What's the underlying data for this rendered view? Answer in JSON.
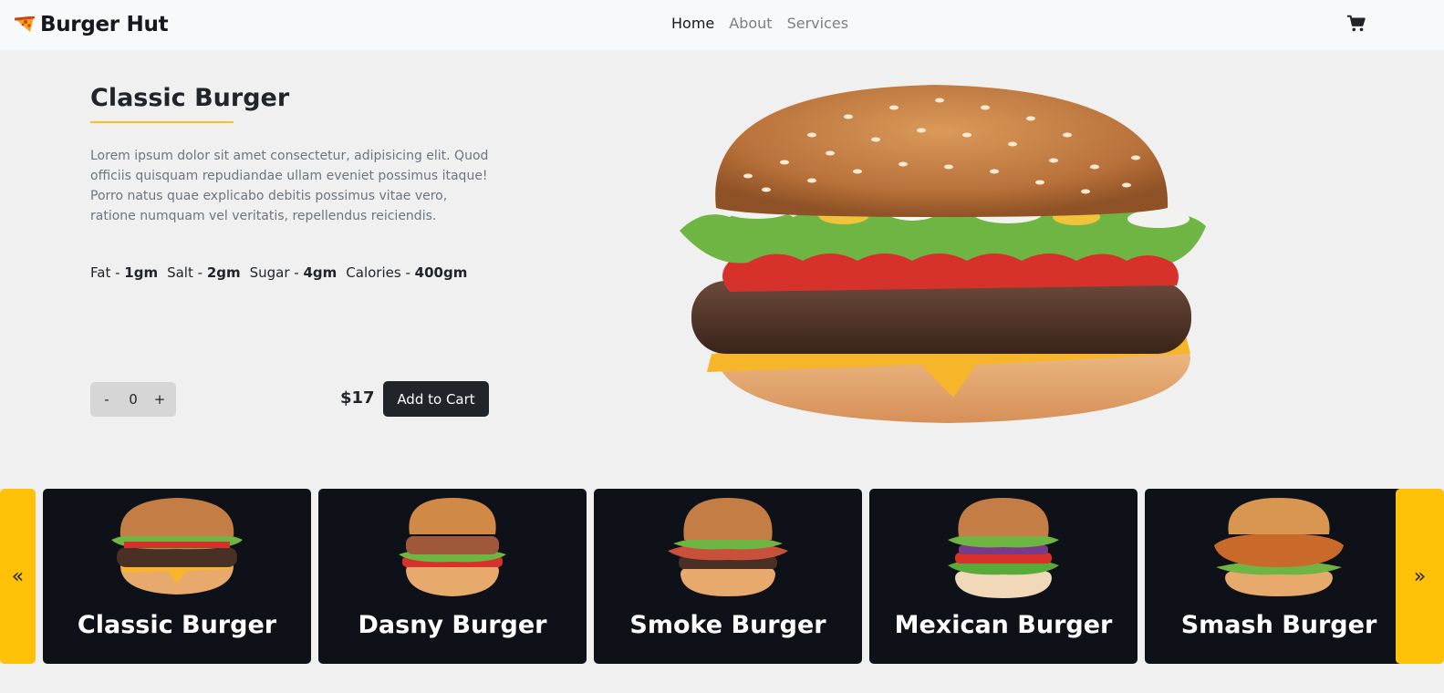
{
  "navbar": {
    "brand": "Burger Hut",
    "links": [
      "Home",
      "About",
      "Services"
    ],
    "active": "Home"
  },
  "product": {
    "title": "Classic Burger",
    "description": "Lorem ipsum dolor sit amet consectetur, adipisicing elit. Quod officiis quisquam repudiandae ullam eveniet possimus itaque! Porro natus quae explicabo debitis possimus vitae vero, ratione numquam vel veritatis, repellendus reiciendis.",
    "nutrition": [
      {
        "label": "Fat - ",
        "value": "1gm"
      },
      {
        "label": "Salt - ",
        "value": "2gm"
      },
      {
        "label": "Sugar - ",
        "value": "4gm"
      },
      {
        "label": "Calories - ",
        "value": "400gm"
      }
    ],
    "quantity": {
      "minus": "-",
      "value": "0",
      "plus": "+"
    },
    "price": "$17",
    "add_to_cart": "Add to Cart"
  },
  "carousel": {
    "prev": "«",
    "next": "»",
    "items": [
      {
        "name": "Classic Burger"
      },
      {
        "name": "Dasny Burger"
      },
      {
        "name": "Smoke Burger"
      },
      {
        "name": "Mexican Burger"
      },
      {
        "name": "Smash Burger"
      }
    ]
  },
  "colors": {
    "accent": "#ffc107",
    "dark": "#212529",
    "card_bg": "#0f1118",
    "underline": "#f7c31c"
  },
  "icons": {
    "brand": "pizza-slice-icon",
    "cart": "cart-icon",
    "prev": "double-chevron-left-icon",
    "next": "double-chevron-right-icon"
  }
}
